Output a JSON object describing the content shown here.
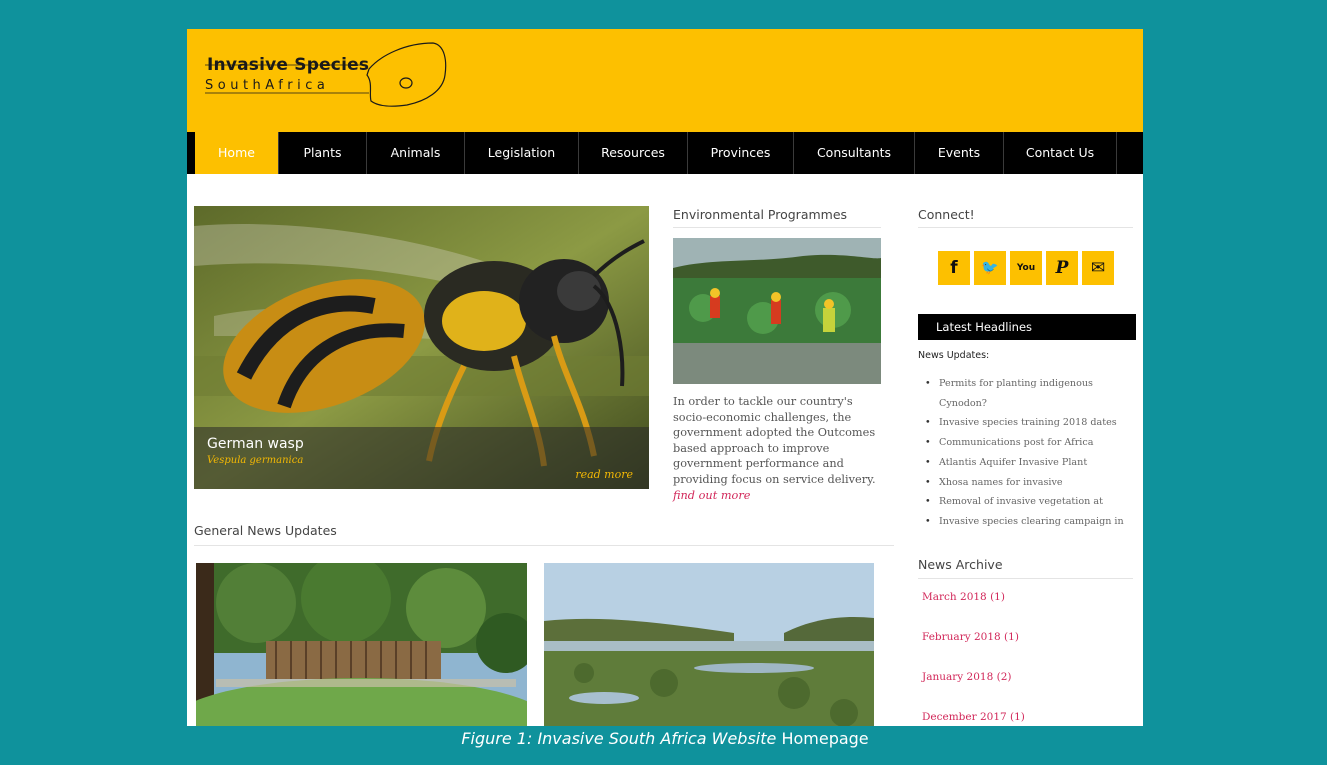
{
  "header": {
    "logo_title": "Invasive Species",
    "logo_subtitle": "SouthAfrica",
    "brand_color": "#fdc000"
  },
  "nav": {
    "items": [
      {
        "label": "Home",
        "active": true
      },
      {
        "label": "Plants"
      },
      {
        "label": "Animals"
      },
      {
        "label": "Legislation"
      },
      {
        "label": "Resources"
      },
      {
        "label": "Provinces"
      },
      {
        "label": "Consultants"
      },
      {
        "label": "Events"
      },
      {
        "label": "Contact Us"
      }
    ]
  },
  "feature": {
    "title": "German wasp",
    "scientific_name": "Vespula germanica",
    "read_more": "read more"
  },
  "environmental": {
    "heading": "Environmental Programmes",
    "text": "In order to tackle our country's socio-economic challenges, the government adopted the Outcomes based approach to improve government performance and providing focus on service delivery.",
    "link": "find out more"
  },
  "general_news": {
    "heading": "General News Updates"
  },
  "sidebar": {
    "connect_heading": "Connect!",
    "social": [
      {
        "icon": "facebook-icon",
        "glyph": "f"
      },
      {
        "icon": "twitter-icon",
        "glyph": "🐦"
      },
      {
        "icon": "youtube-icon",
        "glyph": "You"
      },
      {
        "icon": "pinterest-icon",
        "glyph": "P"
      },
      {
        "icon": "email-icon",
        "glyph": "✉"
      }
    ],
    "latest_heading": "Latest Headlines",
    "news_label": "News Updates:",
    "headlines": [
      "Permits for planting indigenous",
      "Cynodon?",
      "Invasive species training 2018 dates",
      "Communications post for Africa",
      "Atlantis Aquifer Invasive Plant",
      "Xhosa names for invasive",
      "Removal of invasive vegetation at",
      "Invasive species clearing campaign in"
    ],
    "archive_heading": "News Archive",
    "archive": [
      "March 2018 (1)",
      "February 2018 (1)",
      "January 2018 (2)",
      "December 2017 (1)"
    ]
  },
  "caption": {
    "italic": "Figure 1: Invasive South Africa Website",
    "normal": "Homepage"
  }
}
